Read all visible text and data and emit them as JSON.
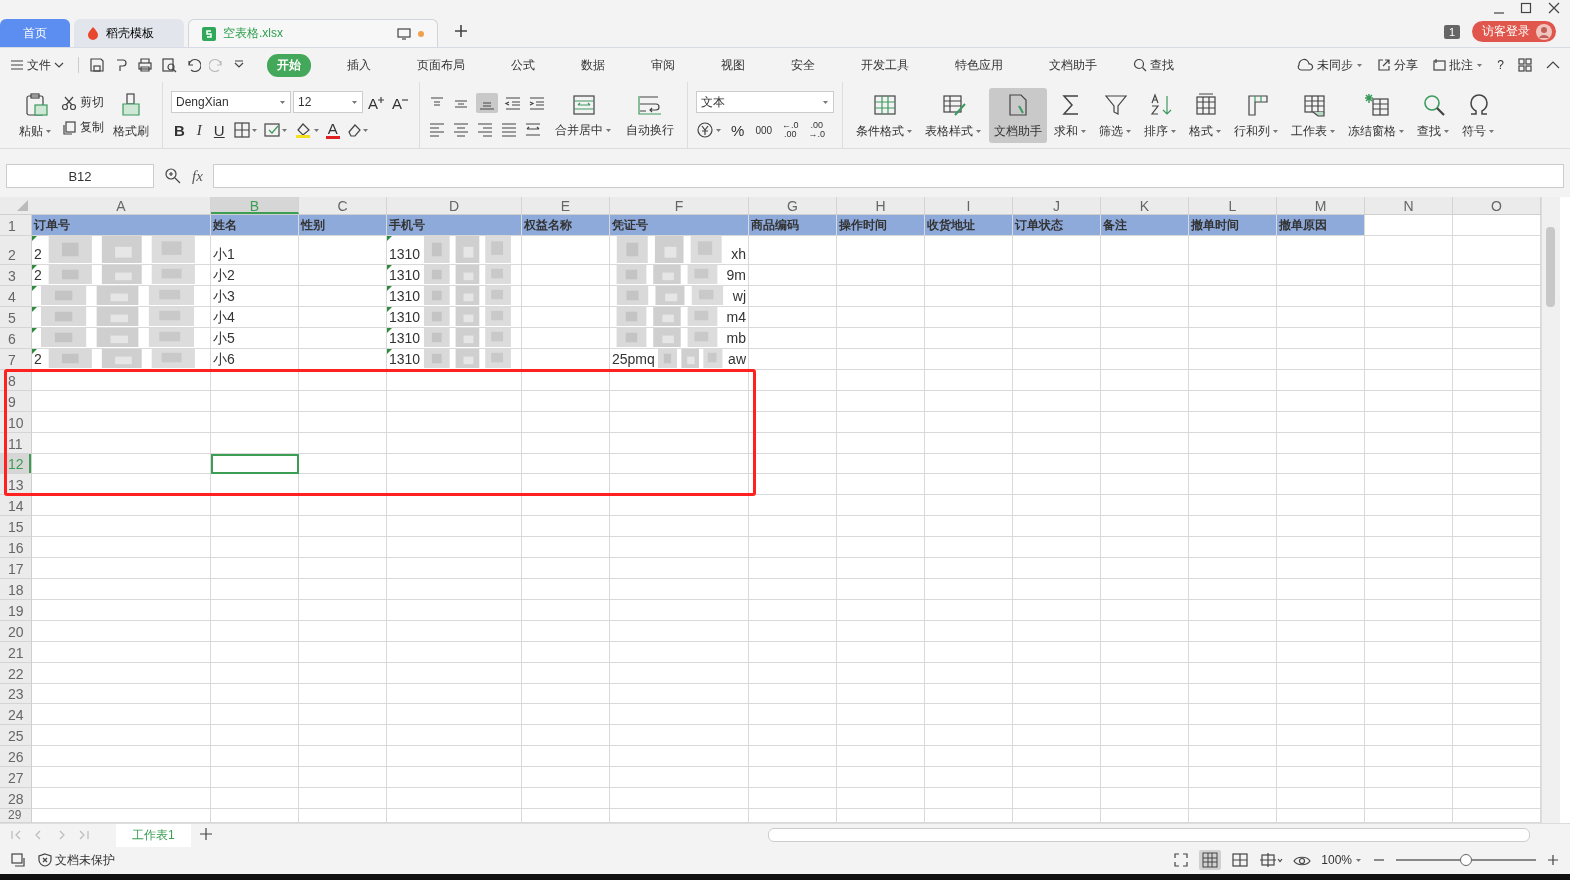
{
  "tabs": [
    {
      "label": "首页",
      "selected": false,
      "kind": "home"
    },
    {
      "label": "稻壳模板",
      "selected": false,
      "kind": "docer"
    },
    {
      "label": "空表格.xlsx",
      "selected": true,
      "kind": "sheet"
    }
  ],
  "window_badge": "1",
  "login_button": "访客登录",
  "menu": {
    "file": "文件",
    "tabs": [
      {
        "label": "开始",
        "selected": true
      },
      {
        "label": "插入",
        "selected": false
      },
      {
        "label": "页面布局",
        "selected": false
      },
      {
        "label": "公式",
        "selected": false
      },
      {
        "label": "数据",
        "selected": false
      },
      {
        "label": "审阅",
        "selected": false
      },
      {
        "label": "视图",
        "selected": false
      },
      {
        "label": "安全",
        "selected": false
      },
      {
        "label": "开发工具",
        "selected": false
      },
      {
        "label": "特色应用",
        "selected": false
      },
      {
        "label": "文档助手",
        "selected": false
      }
    ],
    "search": "查找",
    "right": [
      {
        "label": "未同步",
        "dropdown": true
      },
      {
        "label": "分享",
        "dropdown": false
      },
      {
        "label": "批注",
        "dropdown": true
      }
    ],
    "help": "?"
  },
  "ribbon": {
    "paste": "粘贴",
    "cut": "剪切",
    "copy": "复制",
    "format_painter": "格式刷",
    "font": "DengXian",
    "size": "12",
    "grow": "A",
    "shrink": "A",
    "bold": "B",
    "italic": "I",
    "underline": "U",
    "font_color": "A",
    "merge": "合并居中",
    "wrap": "自动换行",
    "number_format": "文本",
    "percent": "%",
    "thousands": "000",
    "decimals": [
      {
        "top": "←.0",
        "bottom": ".00"
      },
      {
        "top": ".00",
        "bottom": "→.0"
      }
    ],
    "buttons": [
      {
        "label": "条件格式",
        "dropdown": true,
        "selected": false
      },
      {
        "label": "表格样式",
        "dropdown": true,
        "selected": false
      },
      {
        "label": "文档助手",
        "dropdown": false,
        "selected": true
      },
      {
        "label": "求和",
        "dropdown": true,
        "selected": false
      },
      {
        "label": "筛选",
        "dropdown": true,
        "selected": false
      },
      {
        "label": "排序",
        "dropdown": true,
        "selected": false
      },
      {
        "label": "格式",
        "dropdown": true,
        "selected": false
      },
      {
        "label": "行和列",
        "dropdown": true,
        "selected": false
      },
      {
        "label": "工作表",
        "dropdown": true,
        "selected": false
      },
      {
        "label": "冻结窗格",
        "dropdown": true,
        "selected": false
      },
      {
        "label": "查找",
        "dropdown": true,
        "selected": false
      },
      {
        "label": "符号",
        "dropdown": true,
        "selected": false
      }
    ]
  },
  "formula_bar": {
    "name_box": "B12",
    "fx": "fx"
  },
  "columns": [
    {
      "label": "A",
      "selected": false
    },
    {
      "label": "B",
      "selected": true
    },
    {
      "label": "C",
      "selected": false
    },
    {
      "label": "D",
      "selected": false
    },
    {
      "label": "E",
      "selected": false
    },
    {
      "label": "F",
      "selected": false
    },
    {
      "label": "G",
      "selected": false
    },
    {
      "label": "H",
      "selected": false
    },
    {
      "label": "I",
      "selected": false
    },
    {
      "label": "J",
      "selected": false
    },
    {
      "label": "K",
      "selected": false
    },
    {
      "label": "L",
      "selected": false
    },
    {
      "label": "M",
      "selected": false
    },
    {
      "label": "N",
      "selected": false
    },
    {
      "label": "O",
      "selected": false
    }
  ],
  "rows": [
    {
      "number": "1",
      "selected": false,
      "kind": "header",
      "cells": {
        "A": {
          "text": "订单号"
        },
        "B": {
          "text": "姓名"
        },
        "C": {
          "text": "性别"
        },
        "D": {
          "text": "手机号"
        },
        "E": {
          "text": "权益名称"
        },
        "F": {
          "text": "凭证号"
        },
        "G": {
          "text": "商品编码"
        },
        "H": {
          "text": "操作时间"
        },
        "I": {
          "text": "收货地址"
        },
        "J": {
          "text": "订单状态"
        },
        "K": {
          "text": "备注"
        },
        "L": {
          "text": "撤单时间"
        },
        "M": {
          "text": "撤单原因"
        }
      }
    },
    {
      "number": "2",
      "selected": false,
      "kind": "data",
      "cells": {
        "A": {
          "text": "2",
          "masked": true,
          "flag": true
        },
        "B": {
          "text": "小1"
        },
        "D": {
          "text": "1310",
          "masked": true,
          "flag": true
        },
        "F": {
          "text_after": "xh",
          "masked": true
        }
      }
    },
    {
      "number": "3",
      "selected": false,
      "kind": "data",
      "cells": {
        "A": {
          "text": "2",
          "masked": true,
          "flag": true
        },
        "B": {
          "text": "小2"
        },
        "D": {
          "text": "1310",
          "masked": true,
          "flag": true
        },
        "F": {
          "text_after": "9m",
          "masked": true
        }
      }
    },
    {
      "number": "4",
      "selected": false,
      "kind": "data",
      "cells": {
        "A": {
          "masked": true,
          "flag": true
        },
        "B": {
          "text": "小3"
        },
        "D": {
          "text": "1310",
          "masked": true,
          "flag": true
        },
        "F": {
          "text_after": "wj",
          "masked": true
        }
      }
    },
    {
      "number": "5",
      "selected": false,
      "kind": "data",
      "cells": {
        "A": {
          "masked": true,
          "flag": true
        },
        "B": {
          "text": "小4"
        },
        "D": {
          "text": "1310",
          "masked": true,
          "flag": true
        },
        "F": {
          "text_after": "m4",
          "masked": true
        }
      }
    },
    {
      "number": "6",
      "selected": false,
      "kind": "data",
      "cells": {
        "A": {
          "masked": true,
          "flag": true
        },
        "B": {
          "text": "小5"
        },
        "D": {
          "text": "1310",
          "masked": true,
          "flag": true
        },
        "F": {
          "text_after": "mb",
          "masked": true
        }
      }
    },
    {
      "number": "7",
      "selected": false,
      "kind": "data",
      "cells": {
        "A": {
          "text": "2",
          "masked": true,
          "flag": true
        },
        "B": {
          "text": "小6"
        },
        "D": {
          "text": "1310",
          "masked": true,
          "flag": true
        },
        "F": {
          "text": "25pmq",
          "text_after": "aw",
          "masked": true
        }
      }
    },
    {
      "number": "8",
      "selected": false,
      "kind": "data"
    },
    {
      "number": "9",
      "selected": false,
      "kind": "data"
    },
    {
      "number": "10",
      "selected": false,
      "kind": "data"
    },
    {
      "number": "11",
      "selected": false,
      "kind": "data"
    },
    {
      "number": "12",
      "selected": true,
      "kind": "data",
      "cells": {
        "B": {
          "selected": true
        }
      }
    },
    {
      "number": "13",
      "selected": false,
      "kind": "data"
    },
    {
      "number": "14",
      "selected": false,
      "kind": "data"
    },
    {
      "number": "15",
      "selected": false,
      "kind": "data"
    },
    {
      "number": "16",
      "selected": false,
      "kind": "data"
    },
    {
      "number": "17",
      "selected": false,
      "kind": "data"
    },
    {
      "number": "18",
      "selected": false,
      "kind": "data"
    },
    {
      "number": "19",
      "selected": false,
      "kind": "data"
    },
    {
      "number": "20",
      "selected": false,
      "kind": "data"
    },
    {
      "number": "21",
      "selected": false,
      "kind": "data"
    },
    {
      "number": "22",
      "selected": false,
      "kind": "data"
    },
    {
      "number": "23",
      "selected": false,
      "kind": "data"
    },
    {
      "number": "24",
      "selected": false,
      "kind": "data"
    },
    {
      "number": "25",
      "selected": false,
      "kind": "data"
    },
    {
      "number": "26",
      "selected": false,
      "kind": "data"
    },
    {
      "number": "27",
      "selected": false,
      "kind": "data"
    },
    {
      "number": "28",
      "selected": false,
      "kind": "data"
    },
    {
      "number": "29",
      "selected": false,
      "kind": "data"
    }
  ],
  "annotation": {
    "kind": "rectangle",
    "color": "#ff2020"
  },
  "sheets": [
    {
      "label": "工作表1",
      "selected": true
    }
  ],
  "status_bar": {
    "protection": "文档未保护",
    "zoom": "100%",
    "zoom_slider": {
      "level": 0.5
    }
  }
}
